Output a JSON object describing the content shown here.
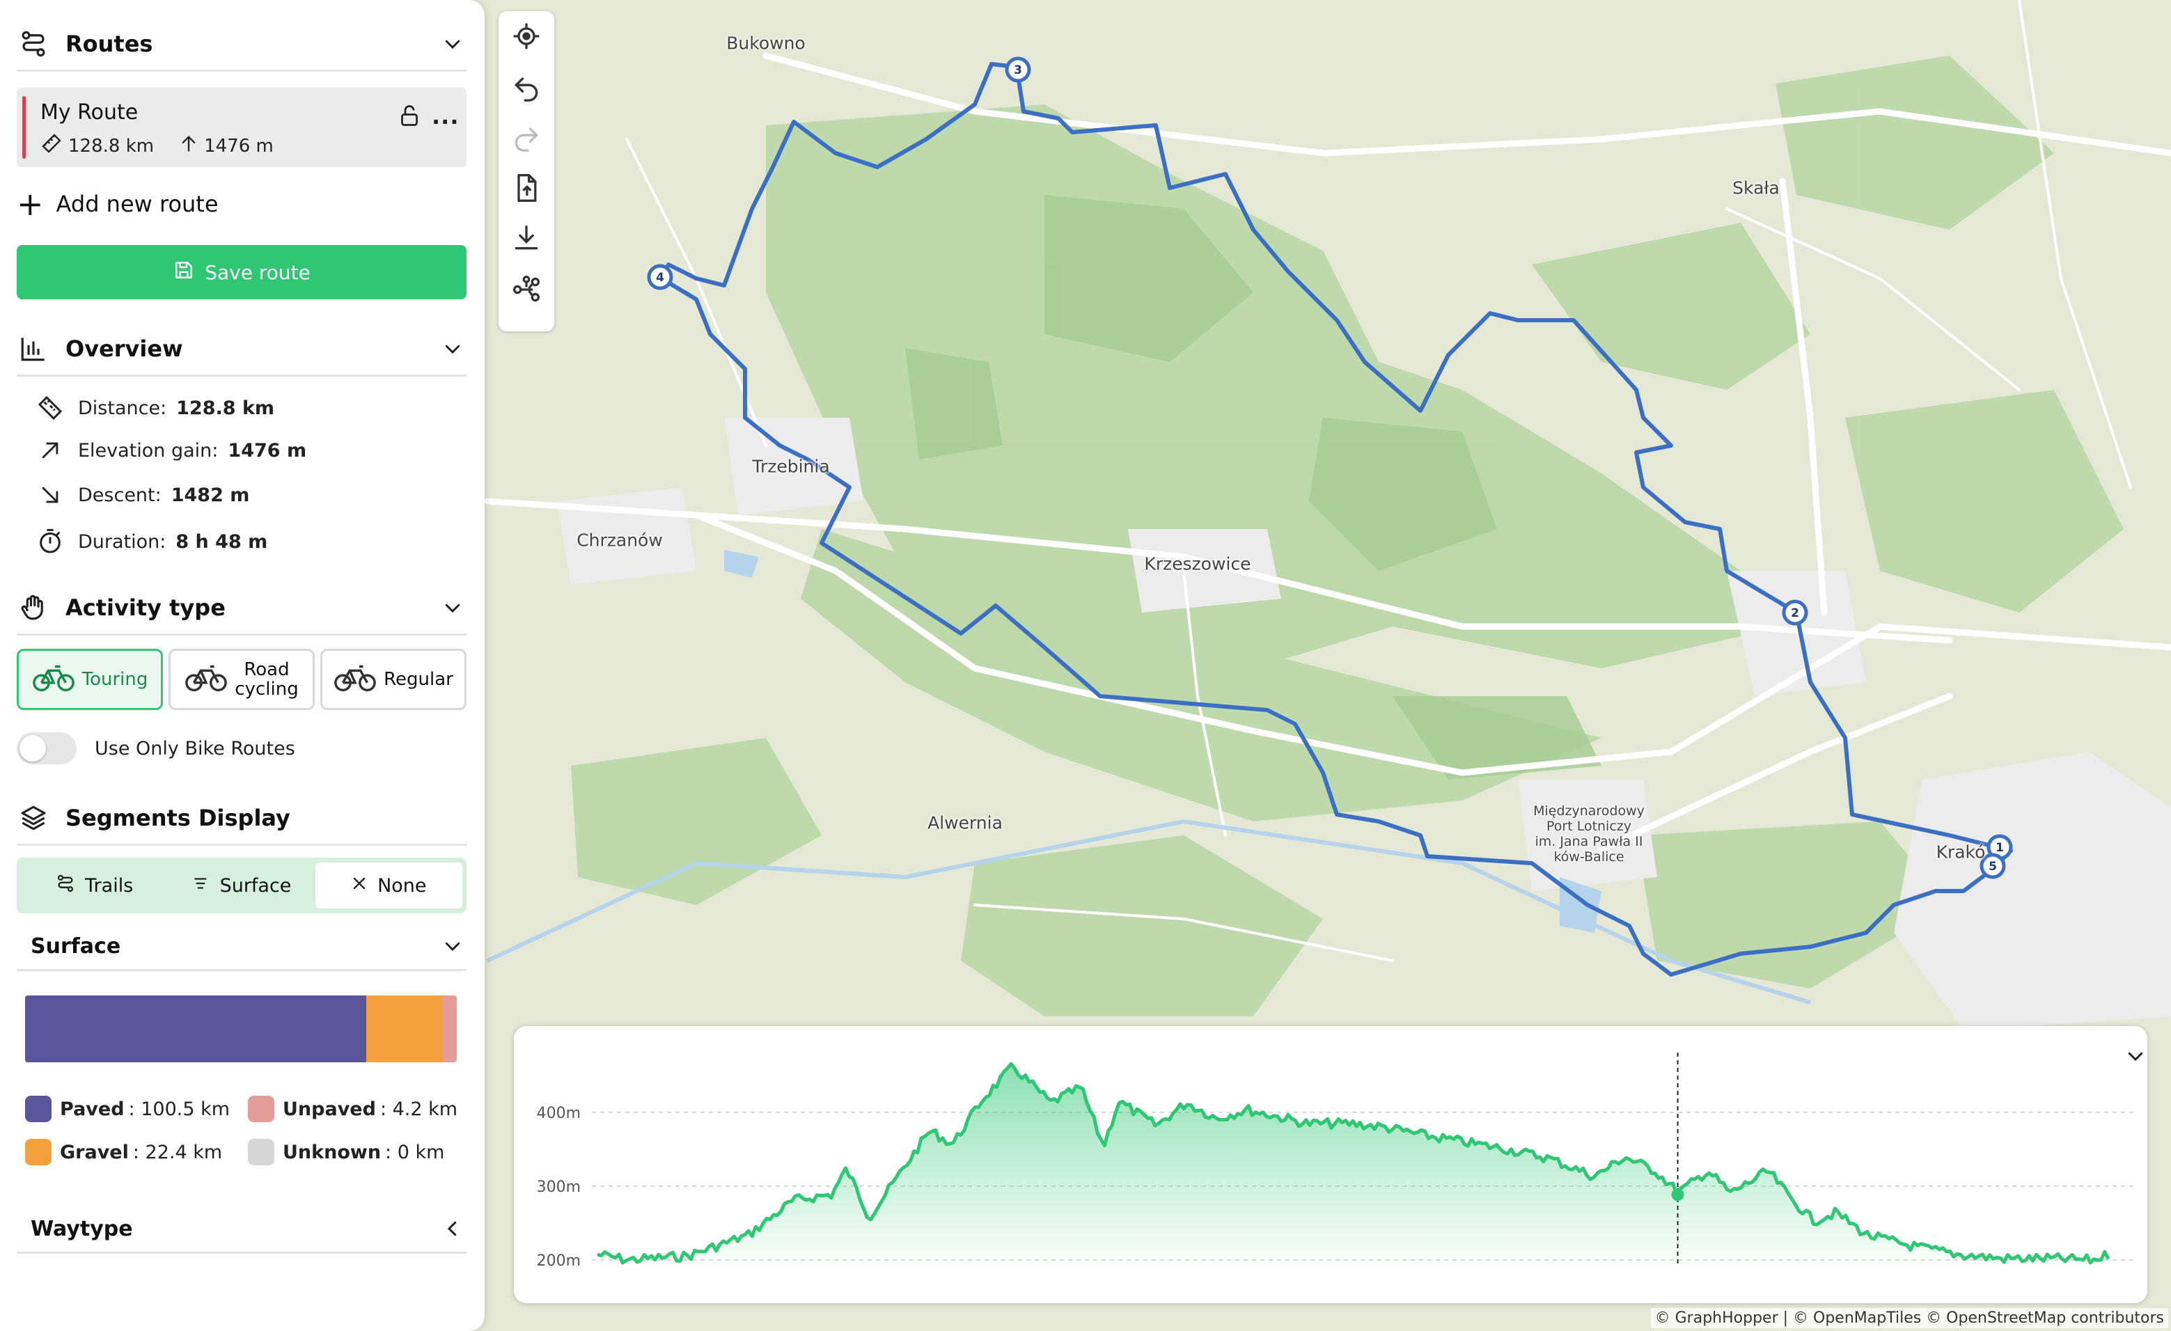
{
  "map": {
    "labels": [
      {
        "name": "bukowno",
        "text": "Bukowno"
      },
      {
        "name": "skala",
        "text": "Skała"
      },
      {
        "name": "trzebinia",
        "text": "Trzebinia"
      },
      {
        "name": "chrzanow",
        "text": "Chrzanów"
      },
      {
        "name": "krzeszowice",
        "text": "Krzeszowice"
      },
      {
        "name": "alwernia",
        "text": "Alwernia"
      },
      {
        "name": "krakow",
        "text": "Krakó"
      },
      {
        "name": "airport",
        "text": "Międzynarodowy\nPort Lotniczy\nim. Jana Pawła II\nków-Balice"
      }
    ],
    "waypoints": [
      "1",
      "2",
      "3",
      "4",
      "5"
    ],
    "route_color": "#3b6fc4",
    "attribution": "© GraphHopper | © OpenMapTiles © OpenStreetMap contributors"
  },
  "sidebar": {
    "routes_title": "Routes",
    "route": {
      "name": "My Route",
      "distance": "128.8 km",
      "elevation": "1476 m"
    },
    "add_route_label": "Add new route",
    "save_label": "Save route",
    "overview": {
      "title": "Overview",
      "rows": [
        {
          "label": "Distance:",
          "value": "128.8 km"
        },
        {
          "label": "Elevation gain:",
          "value": "1476 m"
        },
        {
          "label": "Descent:",
          "value": "1482 m"
        },
        {
          "label": "Duration:",
          "value": "8 h 48 m"
        }
      ]
    },
    "activity": {
      "title": "Activity type",
      "options": [
        {
          "label": "Touring",
          "active": true
        },
        {
          "label": "Road\ncycling",
          "active": false
        },
        {
          "label": "Regular",
          "active": false
        }
      ]
    },
    "bike_routes_toggle": {
      "label": "Use Only Bike Routes",
      "on": false
    },
    "segments": {
      "title": "Segments Display",
      "options": [
        {
          "label": "Trails",
          "active": false
        },
        {
          "label": "Surface",
          "active": false
        },
        {
          "label": "None",
          "active": true
        }
      ]
    },
    "surface": {
      "title": "Surface",
      "items": [
        {
          "name": "Paved",
          "value": ": 100.5 km",
          "km": 100.5,
          "color": "#5a559a"
        },
        {
          "name": "Gravel",
          "value": ": 22.4 km",
          "km": 22.4,
          "color": "#f3a03e"
        },
        {
          "name": "Unpaved",
          "value": ": 4.2 km",
          "km": 4.2,
          "color": "#e39c9a"
        },
        {
          "name": "Unknown",
          "value": ": 0 km",
          "km": 0,
          "color": "#d6d6d6"
        }
      ]
    },
    "waytype_title": "Waytype"
  },
  "elevation": {
    "y_ticks": [
      "400m",
      "300m",
      "200m"
    ],
    "line_color": "#2ec773",
    "cursor_fraction": 0.715
  }
}
